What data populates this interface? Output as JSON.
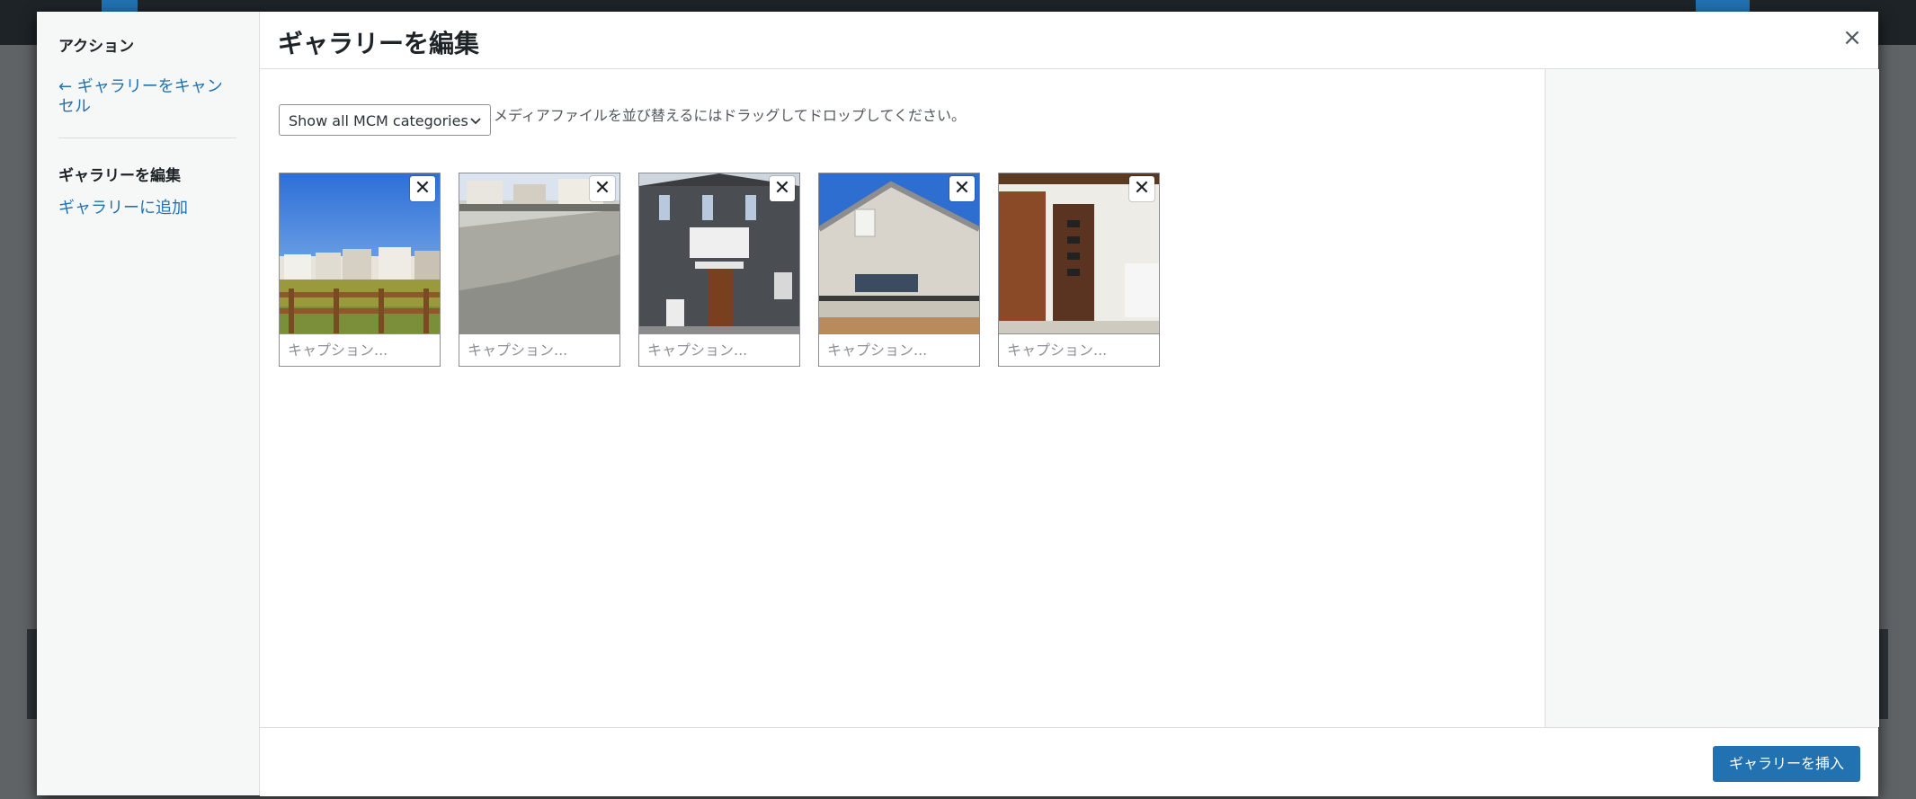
{
  "modal": {
    "title": "ギャラリーを編集",
    "close_label": "×"
  },
  "menu": {
    "actions_title": "アクション",
    "cancel_gallery": "← ギャラリーをキャンセル",
    "edit_gallery": "ギャラリーを編集",
    "add_to_gallery": "ギャラリーに追加"
  },
  "content": {
    "filter_select": "Show all MCM categories",
    "instructions": "メディアファイルを並び替えるにはドラッグしてドロップしてください。",
    "items": [
      {
        "caption_placeholder": "キャプション...",
        "remove_label": "✕"
      },
      {
        "caption_placeholder": "キャプション...",
        "remove_label": "✕"
      },
      {
        "caption_placeholder": "キャプション...",
        "remove_label": "✕"
      },
      {
        "caption_placeholder": "キャプション...",
        "remove_label": "✕"
      },
      {
        "caption_placeholder": "キャプション...",
        "remove_label": "✕"
      }
    ]
  },
  "toolbar": {
    "insert_label": "ギャラリーを挿入"
  },
  "colors": {
    "accent": "#2271b1",
    "menu_bg": "#f6f7f7",
    "admin_bar": "#1d2327"
  }
}
